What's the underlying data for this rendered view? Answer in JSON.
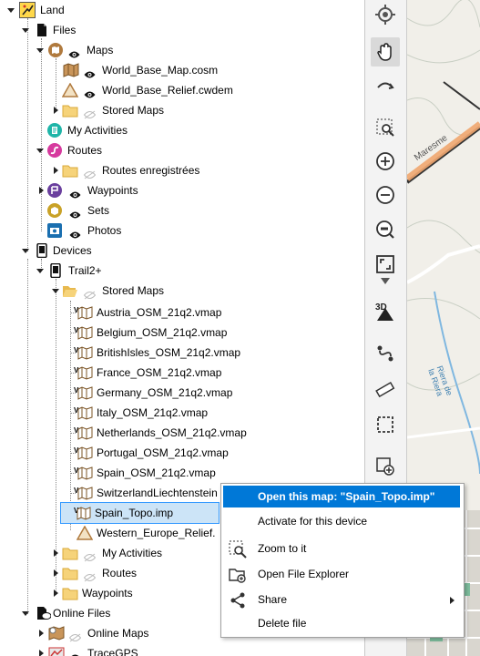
{
  "tree": {
    "land": "Land",
    "files": "Files",
    "maps": "Maps",
    "world_base_map": "World_Base_Map.cosm",
    "world_base_relief": "World_Base_Relief.cwdem",
    "stored_maps": "Stored Maps",
    "my_activities": "My Activities",
    "routes": "Routes",
    "routes_enregistrees": "Routes enregistrées",
    "waypoints": "Waypoints",
    "sets": "Sets",
    "photos": "Photos",
    "devices": "Devices",
    "trail2": "Trail2+",
    "device_stored_maps": "Stored Maps",
    "vmaps": [
      "Austria_OSM_21q2.vmap",
      "Belgium_OSM_21q2.vmap",
      "BritishIsles_OSM_21q2.vmap",
      "France_OSM_21q2.vmap",
      "Germany_OSM_21q2.vmap",
      "Italy_OSM_21q2.vmap",
      "Netherlands_OSM_21q2.vmap",
      "Portugal_OSM_21q2.vmap",
      "Spain_OSM_21q2.vmap",
      "SwitzerlandLiechtenstein"
    ],
    "spain_topo": "Spain_Topo.imp",
    "western_europe": "Western_Europe_Relief.",
    "device_activities": "My Activities",
    "device_routes": "Routes",
    "device_waypoints": "Waypoints",
    "online_files": "Online Files",
    "online_maps": "Online Maps",
    "tracegps": "TraceGPS"
  },
  "context_menu": {
    "open_map": "Open this map: \"Spain_Topo.imp\"",
    "activate": "Activate for this device",
    "zoom": "Zoom to it",
    "explorer": "Open File Explorer",
    "share": "Share",
    "delete": "Delete file"
  },
  "map": {
    "labels": [
      "Maresme",
      "Riera de la Riera"
    ]
  },
  "colors": {
    "selection": "#cce4f7",
    "menu_highlight": "#0078d7",
    "folder": "#f6d37a",
    "maps_icon": "#b07a3e",
    "activities_icon": "#1fb5a8",
    "routes_icon": "#d63a9e",
    "waypoints_icon": "#6a3f9e",
    "sets_icon": "#c9a227",
    "photos_icon": "#1a6fb0"
  }
}
